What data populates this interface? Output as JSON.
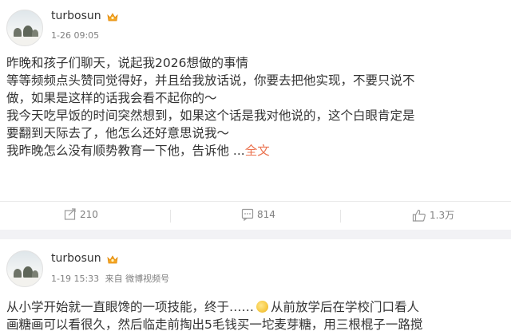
{
  "post1": {
    "username": "turbosun",
    "timestamp": "1-26 09:05",
    "lines": [
      "昨晚和孩子们聊天，说起我2026想做的事情",
      "等等频频点头赞同觉得好，并且给我放话说，你要去把他实现，不要只说不",
      "做，如果是这样的话我会看不起你的～",
      "我今天吃早饭的时间突然想到，如果这个话是我对他说的，这个白眼肯定是",
      "要翻到天际去了，他怎么还好意思说我～"
    ],
    "last_line": "我昨晚怎么没有顺势教育一下他，告诉他 ...",
    "full_text_link": "全文",
    "actions": {
      "repost_count": "210",
      "comment_count": "814",
      "like_count": "1.3万"
    }
  },
  "post2": {
    "username": "turbosun",
    "timestamp": "1-19 15:33",
    "source": "来自 微博视频号",
    "line1_before_emoji": "从小学开始就一直眼馋的一项技能，终于……",
    "line1_after_emoji": "从前放学后在学校门口看人",
    "line2": "画糖画可以看很久，然后临走前掏出5毛钱买一坨麦芽糖，用三根棍子一路搅"
  },
  "icons": {
    "verified": "crown-badge-icon",
    "repost": "repost-icon",
    "comment": "comment-icon",
    "like": "thumbs-up-icon"
  },
  "colors": {
    "link": "#eb7350",
    "meta": "#808080",
    "text": "#333333",
    "badge": "#f5a623"
  }
}
